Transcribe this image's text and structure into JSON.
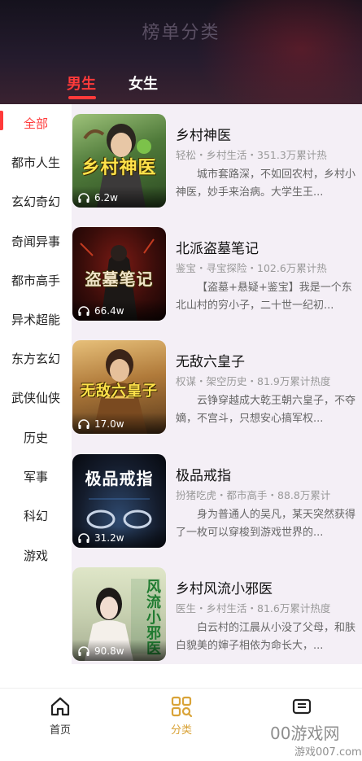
{
  "header": {
    "title": "榜单分类",
    "tabs": [
      {
        "label": "男生",
        "active": true
      },
      {
        "label": "女生",
        "active": false
      }
    ]
  },
  "sidebar": {
    "items": [
      {
        "label": "全部",
        "active": true
      },
      {
        "label": "都市人生"
      },
      {
        "label": "玄幻奇幻"
      },
      {
        "label": "奇闻异事"
      },
      {
        "label": "都市高手"
      },
      {
        "label": "异术超能"
      },
      {
        "label": "东方玄幻"
      },
      {
        "label": "武侠仙侠"
      },
      {
        "label": "历史"
      },
      {
        "label": "军事"
      },
      {
        "label": "科幻"
      },
      {
        "label": "游戏"
      }
    ]
  },
  "books": [
    {
      "title": "乡村神医",
      "meta": "轻松・乡村生活・351.3万累计热",
      "desc": "城市套路深，不如回农村，乡村小神医，妙手来治病。大学生王...",
      "listens": "6.2w",
      "cover_text": "乡村神医"
    },
    {
      "title": "北派盗墓笔记",
      "meta": "鉴宝・寻宝探险・102.6万累计热",
      "desc": "【盗墓+悬疑+鉴宝】我是一个东北山村的穷小子，二十世一纪初...",
      "listens": "66.4w",
      "cover_text": "盗墓笔记"
    },
    {
      "title": "无敌六皇子",
      "meta": "权谋・架空历史・81.9万累计热度",
      "desc": "云铮穿越成大乾王朝六皇子，不夺嫡，不宫斗，只想安心搞军权...",
      "listens": "17.0w",
      "cover_text": "无敌六皇子"
    },
    {
      "title": "极品戒指",
      "meta": "扮猪吃虎・都市高手・88.8万累计",
      "desc": "身为普通人的吴凡，某天突然获得了一枚可以穿梭到游戏世界的...",
      "listens": "31.2w",
      "cover_text": "极品戒指"
    },
    {
      "title": "乡村风流小邪医",
      "meta": "医生・乡村生活・81.6万累计热度",
      "desc": "白云村的江晨从小没了父母，和肤白貌美的婶子相依为命长大，...",
      "listens": "90.8w",
      "cover_text": "风流小邪医"
    }
  ],
  "bottom_nav": [
    {
      "label": "首页",
      "icon": "home-icon"
    },
    {
      "label": "分类",
      "icon": "grid-search-icon",
      "active": true
    },
    {
      "label": "",
      "icon": "game-icon"
    }
  ],
  "watermark": {
    "line1": "00游戏网",
    "line2": "游戏007.com"
  },
  "colors": {
    "accent": "#ff3a3a",
    "nav_active": "#d9a338",
    "list_bg": "#f4eff6"
  }
}
